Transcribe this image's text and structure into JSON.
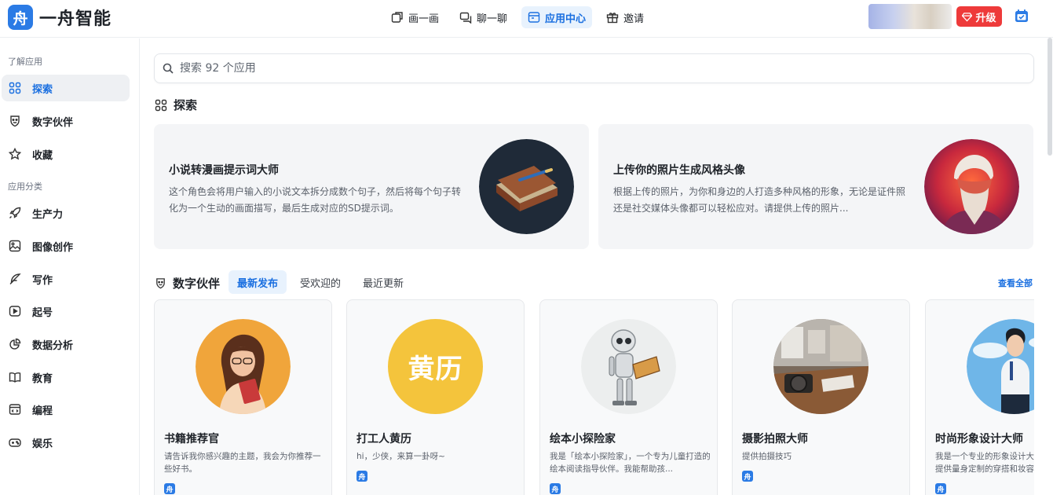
{
  "brand": {
    "logo_glyph": "舟",
    "name": "一舟智能"
  },
  "nav": [
    {
      "label": "画一画",
      "icon": "draw-icon"
    },
    {
      "label": "聊一聊",
      "icon": "chat-icon"
    },
    {
      "label": "应用中心",
      "icon": "app-center-icon",
      "active": true
    },
    {
      "label": "邀请",
      "icon": "gift-icon"
    }
  ],
  "header": {
    "upgrade_label": "升级"
  },
  "sidebar": {
    "section1": "了解应用",
    "items1": [
      {
        "label": "探索",
        "icon": "grid-icon",
        "active": true
      },
      {
        "label": "数字伙伴",
        "icon": "partner-icon"
      },
      {
        "label": "收藏",
        "icon": "star-icon"
      }
    ],
    "section2": "应用分类",
    "items2": [
      {
        "label": "生产力",
        "icon": "rocket-icon"
      },
      {
        "label": "图像创作",
        "icon": "image-icon"
      },
      {
        "label": "写作",
        "icon": "feather-icon"
      },
      {
        "label": "起号",
        "icon": "play-icon"
      },
      {
        "label": "数据分析",
        "icon": "pie-chart-icon"
      },
      {
        "label": "教育",
        "icon": "book-icon"
      },
      {
        "label": "编程",
        "icon": "code-icon"
      },
      {
        "label": "娱乐",
        "icon": "gamepad-icon"
      }
    ]
  },
  "search": {
    "placeholder": "搜索 92 个应用"
  },
  "explore": {
    "title": "探索",
    "features": [
      {
        "title": "小说转漫画提示词大师",
        "desc": "这个角色会将用户输入的小说文本拆分成数个句子，然后将每个句子转化为一个生动的画面描写，最后生成对应的SD提示词。"
      },
      {
        "title": "上传你的照片生成风格头像",
        "desc": "根据上传的照片，为你和身边的人打造多种风格的形象，无论是证件照还是社交媒体头像都可以轻松应对。请提供上传的照片..."
      }
    ]
  },
  "partners": {
    "title": "数字伙伴",
    "tabs": [
      "最新发布",
      "受欢迎的",
      "最近更新"
    ],
    "view_all": "查看全部",
    "cards": [
      {
        "title": "书籍推荐官",
        "desc": "请告诉我你感兴趣的主题，我会为你推荐一些好书。",
        "image": "reading-woman"
      },
      {
        "title": "打工人黄历",
        "desc": "hi，少侠，来算一卦呀~",
        "image_text": "黄历"
      },
      {
        "title": "绘本小探险家",
        "desc": "我是「绘本小探险家」，一个专为儿童打造的绘本阅读指导伙伴。我能帮助孩...",
        "image": "robot-reading"
      },
      {
        "title": "摄影拍照大师",
        "desc": "提供拍摄技巧",
        "image": "camera-desk"
      },
      {
        "title": "时尚形象设计大师",
        "desc": "我是一个专业的形象设计大师，我可以为你提供量身定制的穿搭和妆容建议。",
        "image": "fashion-man"
      }
    ],
    "badge_glyph": "舟"
  }
}
